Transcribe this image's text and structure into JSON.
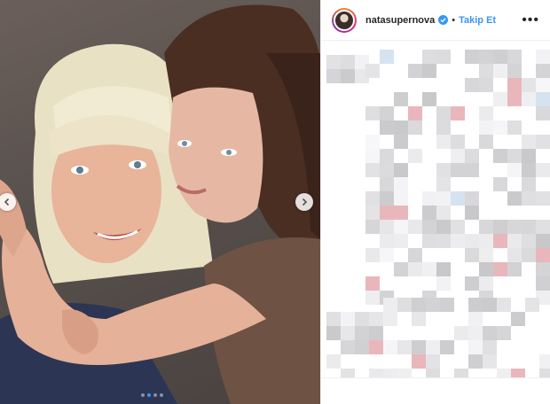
{
  "post": {
    "username": "natasupernova",
    "separator": "•",
    "follow_label": "Takip Et",
    "more_label": "•••"
  },
  "carousel": {
    "total_slides": 4,
    "active_slide": 2
  },
  "icons": {
    "verified": "verified-badge-icon",
    "prev": "chevron-left-icon",
    "next": "chevron-right-icon"
  },
  "colors": {
    "link_blue": "#3897f0",
    "text": "#262626",
    "divider": "#efefef"
  }
}
